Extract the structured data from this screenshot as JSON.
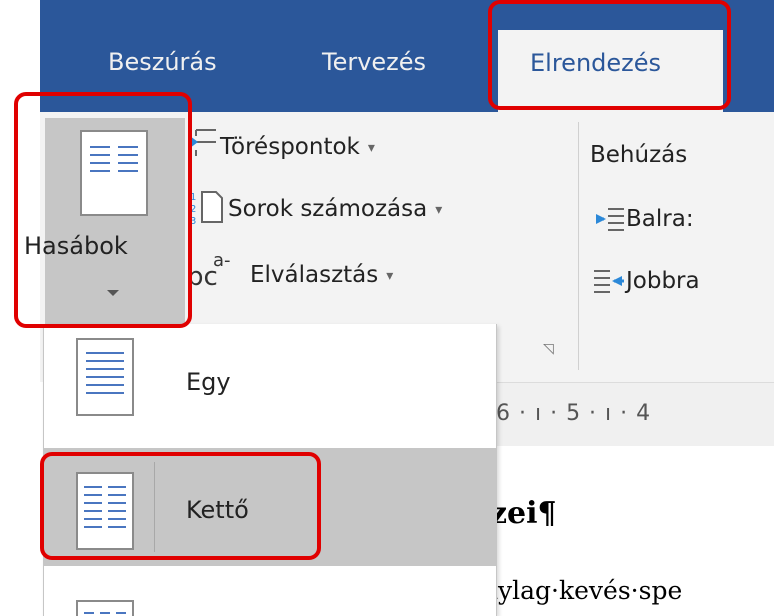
{
  "tabs": {
    "insert": "Beszúrás",
    "design": "Tervezés",
    "layout": "Elrendezés"
  },
  "ribbon": {
    "columns_label": "Hasábok",
    "breaks": "Töréspontok",
    "line_numbers": "Sorok számozása",
    "hyphenation": "Elválasztás",
    "indent_header": "Behúzás",
    "indent_left": "Balra:",
    "indent_right": "Jobbra",
    "hyphen_icon_text": "bc",
    "hyphen_icon_sup": "a-"
  },
  "columns_menu": {
    "one": "Egy",
    "two": "Kettő"
  },
  "ruler": {
    "text": "6 · ı · 5 · ı · 4"
  },
  "document": {
    "heading_fragment": "zei¶",
    "body_fragment": "ıylag·kevés·spe"
  },
  "colors": {
    "ribbon_tab_bar": "#2b579a",
    "highlight_box": "#e00000",
    "hover": "#c6c6c6"
  }
}
